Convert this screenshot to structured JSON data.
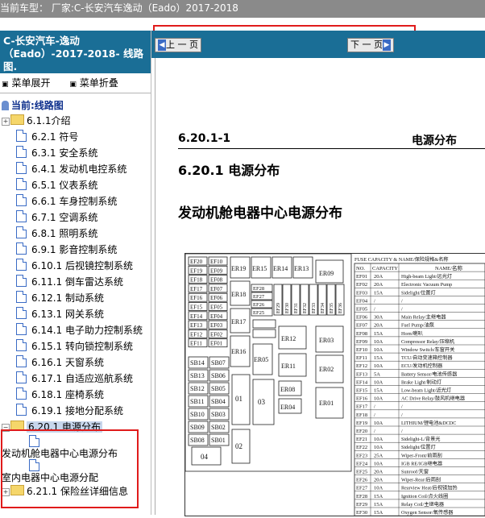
{
  "topbar": {
    "text": "当前车型： 厂家:C-长安汽车逸动（Eado）2017-2018"
  },
  "sidebar": {
    "title": "C-长安汽车-逸动（Eado）-2017-2018- 线路图.",
    "expand_label": "菜单展开",
    "collapse_label": "菜单折叠",
    "current_label": "当前:线路图",
    "items": [
      {
        "label": "6.1.1介绍"
      },
      {
        "label": "6.2.1 符号"
      },
      {
        "label": "6.3.1 安全系统"
      },
      {
        "label": "6.4.1 发动机电控系统"
      },
      {
        "label": "6.5.1 仪表系统"
      },
      {
        "label": "6.6.1 车身控制系统"
      },
      {
        "label": "6.7.1 空调系统"
      },
      {
        "label": "6.8.1 照明系统"
      },
      {
        "label": "6.9.1 影音控制系统"
      },
      {
        "label": "6.10.1 后视镜控制系统"
      },
      {
        "label": "6.11.1 倒车雷达系统"
      },
      {
        "label": "6.12.1 制动系统"
      },
      {
        "label": "6.13.1 网关系统"
      },
      {
        "label": "6.14.1 电子助力控制系统"
      },
      {
        "label": "6.15.1 转向锁控制系统"
      },
      {
        "label": "6.16.1 天窗系统"
      },
      {
        "label": "6.17.1 自适应巡航系统"
      },
      {
        "label": "6.18.1 座椅系统"
      },
      {
        "label": "6.19.1 接地分配系统"
      },
      {
        "label": "6.20.1 电源分布"
      },
      {
        "label": "发动机舱电器中心电源分布"
      },
      {
        "label": "室内电器中心电源分配"
      },
      {
        "label": "6.21.1 保险丝详细信息"
      }
    ]
  },
  "nav": {
    "prev_label": "上 一 页",
    "next_label": "下 一 页"
  },
  "doc": {
    "section_number": "6.20.1-1",
    "section_name": "电源分布",
    "heading": "6.20.1 电源分布",
    "subheading": "发动机舱电器中心电源分布",
    "fuse_table_title": "FUSE CAPACITY & NAME/保险规格&名称",
    "fuse_cols": [
      "NO.",
      "CAPACITY",
      "NAME/名称"
    ],
    "fuses": [
      [
        "EF01",
        "20A",
        "High-beam Light/远光灯"
      ],
      [
        "EF02",
        "20A",
        "Electronic Vacuum Pump"
      ],
      [
        "EF03",
        "15A",
        "Sidelight/位置灯"
      ],
      [
        "EF04",
        "/",
        "/"
      ],
      [
        "EF05",
        "/",
        "/"
      ],
      [
        "EF06",
        "30A",
        "Main Relay/主继电器"
      ],
      [
        "EF07",
        "20A",
        "Fuel Pump/油泵"
      ],
      [
        "EF08",
        "15A",
        "Horn/喇叭"
      ],
      [
        "EF09",
        "10A",
        "Compressor Relay/压缩机"
      ],
      [
        "EF10",
        "10A",
        "Window Switch/车窗开关"
      ],
      [
        "EF11",
        "15A",
        "TCU/自动变速箱控制器"
      ],
      [
        "EF12",
        "10A",
        "ECU/发动机控制器"
      ],
      [
        "EF13",
        "5A",
        "Battery Sensor/电池传感器"
      ],
      [
        "EF14",
        "10A",
        "Brake Light/制动灯"
      ],
      [
        "EF15",
        "15A",
        "Low-beam Light/近光灯"
      ],
      [
        "EF16",
        "10A",
        "AC Drive Relay/鼓风机继电器"
      ],
      [
        "EF17",
        "/",
        "/"
      ],
      [
        "EF18",
        "/",
        "/"
      ],
      [
        "EF19",
        "10A",
        "LITHIUM/锂电池&DCDC"
      ],
      [
        "EF20",
        "/",
        "/"
      ],
      [
        "EF21",
        "10A",
        "Sidelight-L/背景光"
      ],
      [
        "EF22",
        "10A",
        "Sidelight/位置灯"
      ],
      [
        "EF23",
        "25A",
        "Wiper-Front/前雨刮"
      ],
      [
        "EF24",
        "10A",
        "IGB RE/IGB继电器"
      ],
      [
        "EF25",
        "20A",
        "Sunroof/天窗"
      ],
      [
        "EF26",
        "20A",
        "Wiper-Rear/后雨刮"
      ],
      [
        "EF27",
        "10A",
        "Rearview Heat/后视镜加热"
      ],
      [
        "EF28",
        "15A",
        "Ignition Coil/点火线圈"
      ],
      [
        "EF29",
        "15A",
        "Relay Coil/主继电器"
      ],
      [
        "EF30",
        "15A",
        "Oxygen Sensor/氧传感器"
      ],
      [
        "EF31",
        "20A",
        "ECU/发动机控制器"
      ]
    ],
    "col1": [
      "EF20",
      "EF19",
      "EF18",
      "EF17",
      "EF16",
      "EF15",
      "EF14",
      "EF13",
      "EF12",
      "EF11"
    ],
    "col2": [
      "EF10",
      "EF09",
      "EF08",
      "EF07",
      "EF06",
      "EF05",
      "EF04",
      "EF03",
      "EF02",
      "EF01"
    ],
    "top_relays": [
      "ER19",
      "ER15",
      "ER14",
      "ER13"
    ],
    "er09": "ER09",
    "er18": "ER18",
    "er17": "ER17",
    "er16": "ER16",
    "er12": "ER12",
    "er03": "ER03",
    "er11": "ER11",
    "er02": "ER02",
    "er05": "ER05",
    "er08": "ER08",
    "er04": "ER04",
    "er01": "ER01",
    "mid_fuses": [
      "EF28",
      "EF27",
      "EF26",
      "EF25"
    ],
    "vert_fuses": [
      "EF29",
      "EF30",
      "EF31",
      "EF32",
      "EF33",
      "EF34",
      "EF35",
      "EF36"
    ],
    "sb_left": [
      "SB14",
      "SB13",
      "SB12",
      "SB11",
      "SB10",
      "SB09",
      "SB08"
    ],
    "sb_right": [
      "SB07",
      "SB06",
      "SB05",
      "SB04",
      "SB03",
      "SB02",
      "SB01"
    ],
    "blk01": "01",
    "blk02": "02",
    "blk03": "03",
    "blk04": "04"
  }
}
